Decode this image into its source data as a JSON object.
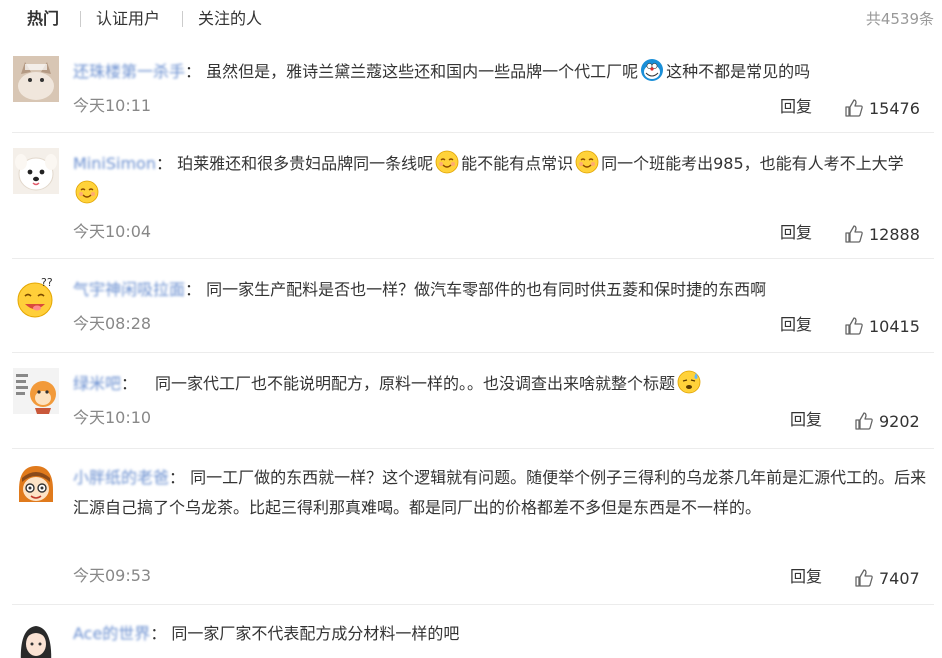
{
  "tabs": [
    {
      "label": "热门"
    },
    {
      "label": "认证用户"
    },
    {
      "label": "关注的人"
    }
  ],
  "total": "共4539条",
  "reply_label": "回复",
  "colon": "：",
  "comments": [
    {
      "user": "还珠楼第一杀手",
      "time": "今天10:11",
      "likes": "15476",
      "parts": [
        "虽然但是，雅诗兰黛兰蔻这些还和国内一些品牌一个代工厂呢",
        "这种不都是常见的吗"
      ],
      "emojis": [
        "doraemon-emoji"
      ]
    },
    {
      "user": "MiniSimon",
      "time": "今天10:04",
      "likes": "12888",
      "parts": [
        "珀莱雅还和很多贵妇品牌同一条线呢",
        "能不能有点常识",
        "同一个班能考出985，也能有人考不上大学",
        ""
      ],
      "emojis": [
        "smile-emoji",
        "smile-emoji",
        "smile-emoji"
      ]
    },
    {
      "user": "气宇神闲吸拉面",
      "time": "今天08:28",
      "likes": "10415",
      "parts": [
        "同一家生产配料是否也一样？做汽车零部件的也有同时供五菱和保时捷的东西啊"
      ],
      "emojis": []
    },
    {
      "user": "绿米吧",
      "time": "今天10:10",
      "likes": "9202",
      "parts": [
        "同一家代工厂也不能说明配方，原料一样的。。也没调查出来啥就整个标题",
        ""
      ],
      "emojis": [
        "sweat-emoji"
      ]
    },
    {
      "user": "小胖纸的老爸",
      "time": "今天09:53",
      "likes": "7407",
      "parts": [
        "同一工厂做的东西就一样？这个逻辑就有问题。随便举个例子三得利的乌龙茶几年前是汇源代工的。后来汇源自己搞了个乌龙茶。比起三得利那真难喝。都是同厂出的价格都差不多但是东西是不一样的。"
      ],
      "emojis": []
    },
    {
      "user": "Ace的世界",
      "time": "",
      "likes": "",
      "parts": [
        "同一家厂家不代表配方成分材料一样的吧"
      ],
      "emojis": []
    }
  ]
}
